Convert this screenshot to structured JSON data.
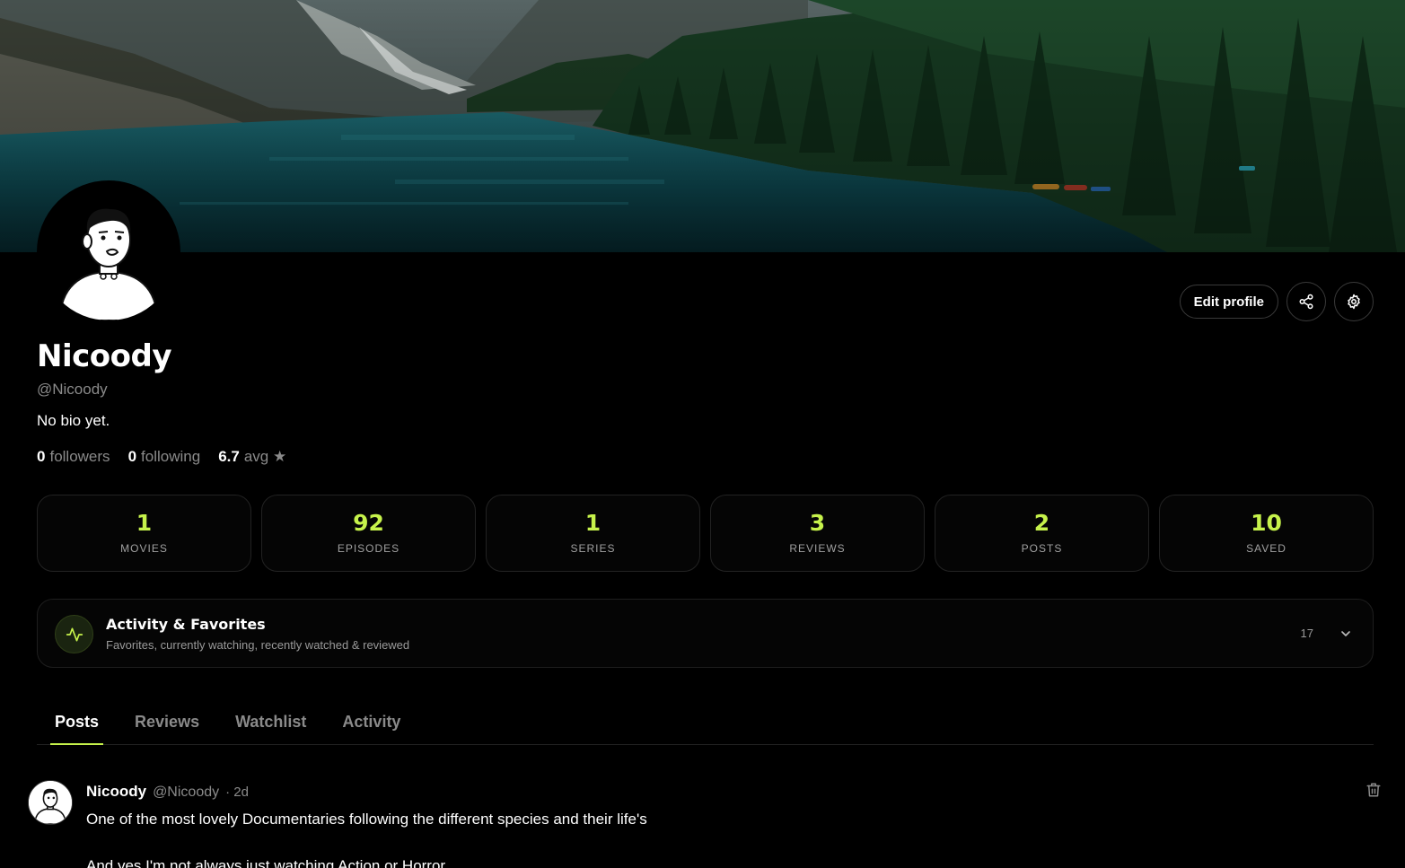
{
  "profile": {
    "name": "Nicoody",
    "handle": "@Nicoody",
    "bio": "No bio yet.",
    "followers_count": "0",
    "followers_label": "followers",
    "following_count": "0",
    "following_label": "following",
    "avg_rating": "6.7",
    "avg_label": "avg ★"
  },
  "actions": {
    "edit_label": "Edit profile",
    "share_icon": "share-icon",
    "settings_icon": "gear-icon"
  },
  "stats": [
    {
      "value": "1",
      "label": "MOVIES"
    },
    {
      "value": "92",
      "label": "EPISODES"
    },
    {
      "value": "1",
      "label": "SERIES"
    },
    {
      "value": "3",
      "label": "REVIEWS"
    },
    {
      "value": "2",
      "label": "POSTS"
    },
    {
      "value": "10",
      "label": "SAVED"
    }
  ],
  "activity": {
    "title": "Activity & Favorites",
    "subtitle": "Favorites, currently watching, recently watched & reviewed",
    "count": "17"
  },
  "tabs": [
    {
      "label": "Posts",
      "active": true
    },
    {
      "label": "Reviews",
      "active": false
    },
    {
      "label": "Watchlist",
      "active": false
    },
    {
      "label": "Activity",
      "active": false
    }
  ],
  "post": {
    "author": "Nicoody",
    "handle": "@Nicoody",
    "time": "· 2d",
    "body": "One of the most lovely Documentaries following the different species and their life's",
    "body2": "And yes I'm not always just watching Action or Horror"
  },
  "colors": {
    "accent": "#c6f24b",
    "background": "#000000",
    "muted": "#8a8a8a"
  }
}
